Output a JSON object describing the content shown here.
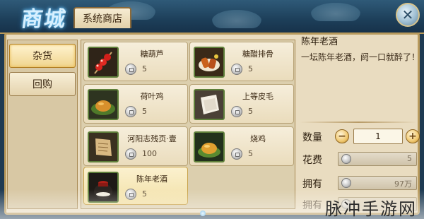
{
  "header": {
    "logo_text": "商城",
    "tab_label": "系统商店",
    "close_icon": "close-icon"
  },
  "sidebar": {
    "items": [
      {
        "label": "杂货",
        "active": true
      },
      {
        "label": "回购",
        "active": false
      }
    ]
  },
  "shop": {
    "currency_icon": "silver-coin-icon",
    "items": [
      {
        "name": "糖葫芦",
        "price": "5",
        "icon": "candied-haws-icon"
      },
      {
        "name": "糖醋排骨",
        "price": "5",
        "icon": "spare-ribs-icon"
      },
      {
        "name": "荷叶鸡",
        "price": "5",
        "icon": "lotus-chicken-icon"
      },
      {
        "name": "上等皮毛",
        "price": "5",
        "icon": "fur-pelt-icon"
      },
      {
        "name": "河阳志残页·壹",
        "price": "100",
        "icon": "scroll-page-icon"
      },
      {
        "name": "烧鸡",
        "price": "5",
        "icon": "roast-chicken-icon"
      },
      {
        "name": "陈年老酒",
        "price": "5",
        "icon": "wine-jar-icon",
        "selected": true
      }
    ]
  },
  "detail": {
    "name": "陈年老酒",
    "description": "一坛陈年老酒，阏一口就醉了！",
    "quantity_label": "数量",
    "quantity": "1",
    "cost_label": "花费",
    "cost": "5",
    "owned_label": "拥有",
    "owned": "97万",
    "owned2_label": "拥有"
  },
  "watermark": "脉冲手游网",
  "colors": {
    "panel": "#e9dcc0",
    "accent_gold": "#c8a24a",
    "frame_blue": "#1e3a52"
  }
}
